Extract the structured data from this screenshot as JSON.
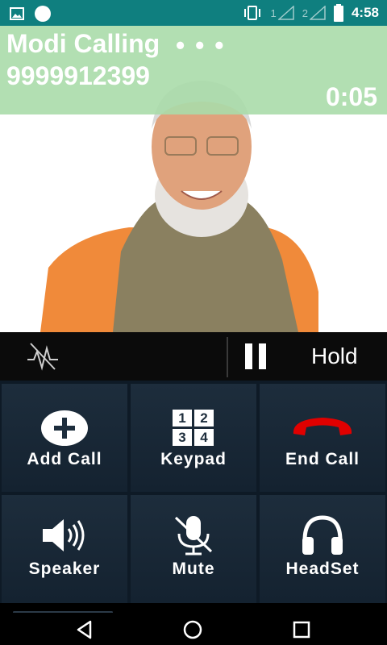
{
  "status_bar": {
    "sim1": "1",
    "sim2": "2",
    "time": "4:58",
    "icons": [
      "image-icon",
      "circle-icon",
      "vibrate-icon",
      "signal-icon",
      "battery-icon"
    ]
  },
  "call": {
    "caller_name": "Modi Calling",
    "dots": "• • •",
    "number": "9999912399",
    "timer": "0:05"
  },
  "controls": {
    "hold_label": "Hold"
  },
  "actions": [
    {
      "label": "Add Call",
      "icon": "add-icon"
    },
    {
      "label": "Keypad",
      "icon": "keypad-icon",
      "keys": [
        "1",
        "2",
        "3",
        "4"
      ]
    },
    {
      "label": "End Call",
      "icon": "end-call-icon"
    },
    {
      "label": "Speaker",
      "icon": "speaker-icon"
    },
    {
      "label": "Mute",
      "icon": "mute-icon"
    },
    {
      "label": "HeadSet",
      "icon": "headset-icon"
    }
  ],
  "colors": {
    "status_bar": "#0f7f7f",
    "banner": "#aadcaa",
    "end_call": "#e00000",
    "grid_bg": "#1d2d3c"
  }
}
